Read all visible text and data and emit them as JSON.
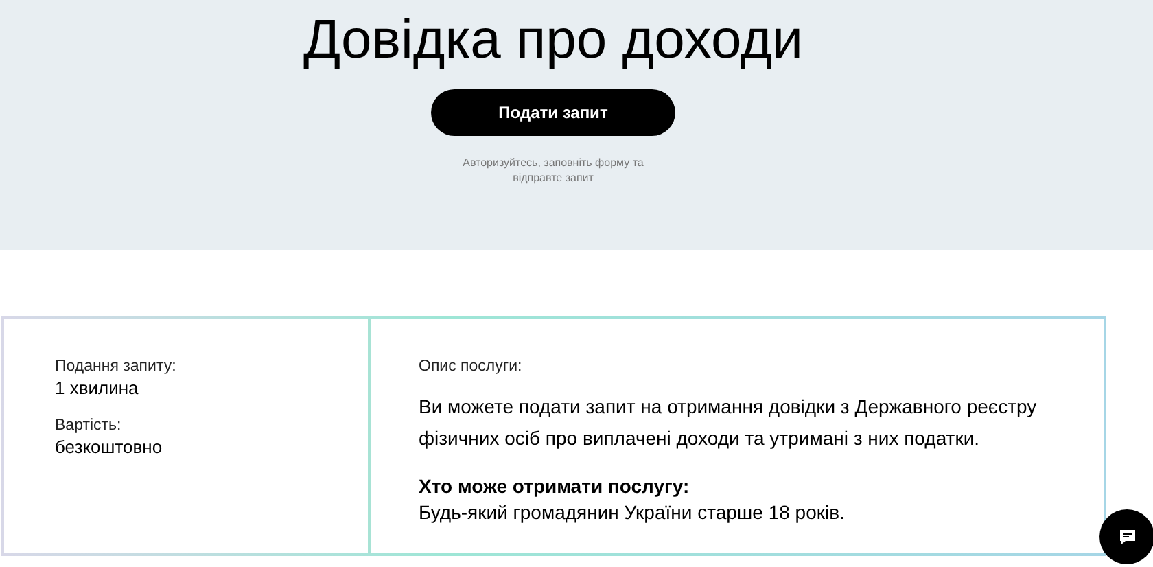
{
  "hero": {
    "title": "Довідка про доходи",
    "button": "Подати запит",
    "hint": "Авторизуйтесь, заповніть форму та відправте запит"
  },
  "info": {
    "facts": [
      {
        "label": "Подання запиту:",
        "value": "1 хвилина"
      },
      {
        "label": "Вартість:",
        "value": "безкоштовно"
      }
    ],
    "description_label": "Опис послуги:",
    "description": "Ви можете подати запит на отримання довідки з Державного реєстру фізичних осіб про виплачені доходи та утримані з них податки.",
    "who_title": "Хто може отримати послугу:",
    "who_text": "Будь-який громадянин України старше 18 років."
  }
}
